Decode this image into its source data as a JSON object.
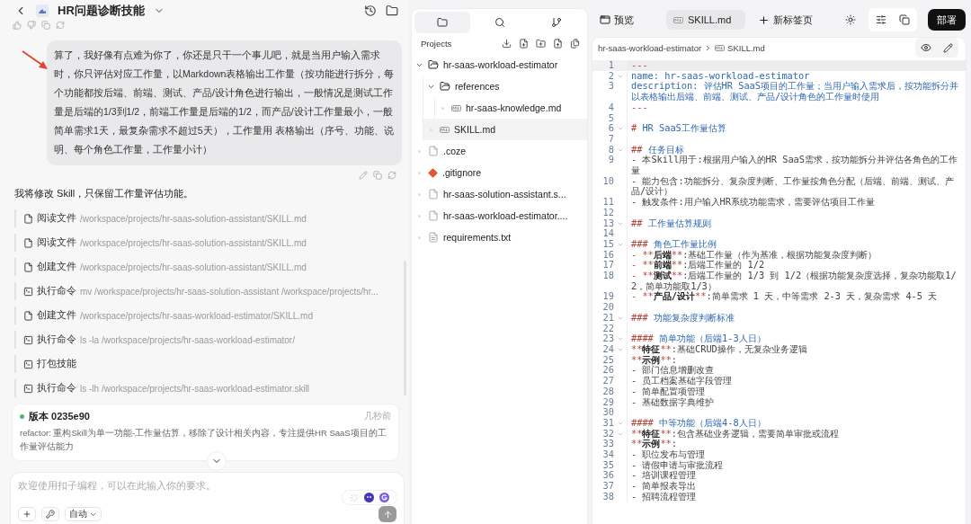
{
  "chat": {
    "title": "HR问题诊断技能",
    "user_message": "算了，我好像有点难为你了，你还是只干一个事儿吧，就是当用户输入需求时，你只评估对应工作量，以Markdown表格输出工作量（按功能进行拆分，每个功能都按后端、前端、测试、产品/设计角色进行输出，一般情况是测试工作量是后端的1/3到1/2，前端工作量是后端的1/2，而产品/设计工作量最小，一般简单需求1天，最复杂需求不超过5天），工作量用 表格输出（序号、功能、说明、每个角色工作量，工作量小计）",
    "assistant_message": "我将修改 Skill，只保留工作量评估功能。",
    "steps": [
      {
        "kind": "file",
        "action": "阅读文件",
        "detail": "/workspace/projects/hr-saas-solution-assistant/SKILL.md"
      },
      {
        "kind": "file",
        "action": "阅读文件",
        "detail": "/workspace/projects/hr-saas-solution-assistant/SKILL.md"
      },
      {
        "kind": "file",
        "action": "创建文件",
        "detail": "/workspace/projects/hr-saas-solution-assistant/SKILL.md"
      },
      {
        "kind": "command",
        "action": "执行命令",
        "detail": "mv /workspace/projects/hr-saas-solution-assistant /workspace/projects/hr..."
      },
      {
        "kind": "file",
        "action": "创建文件",
        "detail": "/workspace/projects/hr-saas-workload-estimator/SKILL.md"
      },
      {
        "kind": "command",
        "action": "执行命令",
        "detail": "ls -la /workspace/projects/hr-saas-workload-estimator/"
      },
      {
        "kind": "command",
        "action": "打包技能"
      },
      {
        "kind": "command",
        "action": "执行命令",
        "detail": "ls -lh /workspace/projects/hr-saas-workload-estimator.skill"
      }
    ],
    "version": {
      "title": "版本 0235e90",
      "time": "几秒前",
      "description": "refactor: 重构Skill为单一功能-工作量估算，移除了设计相关内容，专注提供HR SaaS项目的工作量评估能力"
    },
    "composer": {
      "placeholder": "欢迎使用扣子编程，可以在此输入你的要求。",
      "mode": "自动"
    }
  },
  "explorer": {
    "tabs": [
      {
        "kind": "files",
        "selected": true
      },
      {
        "kind": "search",
        "selected": false
      },
      {
        "kind": "git",
        "selected": false
      }
    ],
    "title": "Projects",
    "tree": [
      {
        "name": "hr-saas-workload-estimator",
        "kind": "folder",
        "expanded": true,
        "selected": false,
        "children": [
          {
            "name": "references",
            "kind": "folder",
            "expanded": true,
            "selected": false,
            "children": [
              {
                "name": "hr-saas-knowledge.md",
                "kind": "markdown",
                "selected": false
              }
            ]
          },
          {
            "name": "SKILL.md",
            "kind": "markdown",
            "selected": true
          }
        ]
      },
      {
        "name": ".coze",
        "kind": "file",
        "selected": false
      },
      {
        "name": ".gitignore",
        "kind": "git",
        "selected": false
      },
      {
        "name": "hr-saas-solution-assistant.s...",
        "kind": "file",
        "selected": false
      },
      {
        "name": "hr-saas-workload-estimator....",
        "kind": "file",
        "selected": false
      },
      {
        "name": "requirements.txt",
        "kind": "text",
        "selected": false
      }
    ]
  },
  "top_bar": {
    "preview": "预览",
    "tabs": [
      {
        "label": "SKILL.md",
        "selected": true
      }
    ],
    "new_tab": "新标签页",
    "deploy": "部署"
  },
  "editor": {
    "breadcrumb": {
      "folder": "hr-saas-workload-estimator",
      "file": "SKILL.md"
    },
    "lines": [
      {
        "n": "1",
        "fold": false,
        "active": true,
        "segs": [
          {
            "kind": "mark",
            "text": "---"
          }
        ]
      },
      {
        "n": "2",
        "fold": true,
        "active": false,
        "segs": [
          {
            "kind": "key",
            "text": "name: hr-saas-workload-estimator"
          }
        ]
      },
      {
        "n": "3",
        "fold": false,
        "active": false,
        "segs": [
          {
            "kind": "key",
            "text": "description: 评估HR SaaS项目的工作量；当用户输入需求后，按功能拆分并以表格输出后端、前端、测试、产品/设计角色的工作量时使用"
          }
        ]
      },
      {
        "n": "4",
        "fold": false,
        "active": false,
        "segs": [
          {
            "kind": "mark",
            "text": "---"
          }
        ]
      },
      {
        "n": "5",
        "fold": false,
        "active": false
      },
      {
        "n": "6",
        "fold": true,
        "active": false,
        "segs": [
          {
            "kind": "mark",
            "text": "# "
          },
          {
            "kind": "heading",
            "text": "HR SaaS工作量估算"
          }
        ]
      },
      {
        "n": "7",
        "fold": false,
        "active": false
      },
      {
        "n": "8",
        "fold": true,
        "active": false,
        "segs": [
          {
            "kind": "mark",
            "text": "## "
          },
          {
            "kind": "heading",
            "text": "任务目标"
          }
        ]
      },
      {
        "n": "9",
        "fold": false,
        "active": false,
        "segs": [
          {
            "kind": "text",
            "text": "- 本Skill用于:根据用户输入的HR SaaS需求，按功能拆分并评估各角色的工作量"
          }
        ]
      },
      {
        "n": "10",
        "fold": false,
        "active": false,
        "segs": [
          {
            "kind": "text",
            "text": "- 能力包含:功能拆分、复杂度判断、工作量按角色分配（后端、前端、测试、产品/设计）"
          }
        ]
      },
      {
        "n": "11",
        "fold": false,
        "active": false,
        "segs": [
          {
            "kind": "text",
            "text": "- 触发条件:用户输入HR系统功能需求，需要评估项目工作量"
          }
        ]
      },
      {
        "n": "12",
        "fold": false,
        "active": false
      },
      {
        "n": "13",
        "fold": true,
        "active": false,
        "segs": [
          {
            "kind": "mark",
            "text": "## "
          },
          {
            "kind": "heading",
            "text": "工作量估算规则"
          }
        ]
      },
      {
        "n": "14",
        "fold": false,
        "active": false
      },
      {
        "n": "15",
        "fold": true,
        "active": false,
        "segs": [
          {
            "kind": "mark",
            "text": "### "
          },
          {
            "kind": "heading",
            "text": "角色工作量比例"
          }
        ]
      },
      {
        "n": "16",
        "fold": false,
        "active": false,
        "segs": [
          {
            "kind": "mark",
            "text": "- **"
          },
          {
            "kind": "bold",
            "text": "后端"
          },
          {
            "kind": "mark",
            "text": "**"
          },
          {
            "kind": "text",
            "text": ":基础工作量（作为基准，根据功能复杂度判断）"
          }
        ]
      },
      {
        "n": "17",
        "fold": false,
        "active": false,
        "segs": [
          {
            "kind": "mark",
            "text": "- **"
          },
          {
            "kind": "bold",
            "text": "前端"
          },
          {
            "kind": "mark",
            "text": "**"
          },
          {
            "kind": "text",
            "text": ":后端工作量的 1/2"
          }
        ]
      },
      {
        "n": "18",
        "fold": false,
        "active": false,
        "segs": [
          {
            "kind": "mark",
            "text": "- **"
          },
          {
            "kind": "bold",
            "text": "测试"
          },
          {
            "kind": "mark",
            "text": "**"
          },
          {
            "kind": "text",
            "text": ":后端工作量的 1/3 到 1/2（根据功能复杂度选择，复杂功能取1/2，简单功能取1/3）"
          }
        ]
      },
      {
        "n": "19",
        "fold": false,
        "active": false,
        "segs": [
          {
            "kind": "mark",
            "text": "- **"
          },
          {
            "kind": "bold",
            "text": "产品/设计"
          },
          {
            "kind": "mark",
            "text": "**"
          },
          {
            "kind": "text",
            "text": ":简单需求 1 天，中等需求 2-3 天，复杂需求 4-5 天"
          }
        ]
      },
      {
        "n": "20",
        "fold": false,
        "active": false
      },
      {
        "n": "21",
        "fold": true,
        "active": false,
        "segs": [
          {
            "kind": "mark",
            "text": "### "
          },
          {
            "kind": "heading",
            "text": "功能复杂度判断标准"
          }
        ]
      },
      {
        "n": "22",
        "fold": false,
        "active": false
      },
      {
        "n": "23",
        "fold": true,
        "active": false,
        "segs": [
          {
            "kind": "mark",
            "text": "#### "
          },
          {
            "kind": "heading",
            "text": "简单功能（后端1-3人日）"
          }
        ]
      },
      {
        "n": "24",
        "fold": true,
        "active": false,
        "segs": [
          {
            "kind": "mark",
            "text": "**"
          },
          {
            "kind": "bold",
            "text": "特征"
          },
          {
            "kind": "mark",
            "text": "**"
          },
          {
            "kind": "text",
            "text": ":基础CRUD操作，无复杂业务逻辑"
          }
        ]
      },
      {
        "n": "25",
        "fold": false,
        "active": false,
        "segs": [
          {
            "kind": "mark",
            "text": "**"
          },
          {
            "kind": "bold",
            "text": "示例"
          },
          {
            "kind": "mark",
            "text": "**"
          },
          {
            "kind": "text",
            "text": ":"
          }
        ]
      },
      {
        "n": "26",
        "fold": false,
        "active": false,
        "segs": [
          {
            "kind": "text",
            "text": "- 部门信息增删改查"
          }
        ]
      },
      {
        "n": "27",
        "fold": false,
        "active": false,
        "segs": [
          {
            "kind": "text",
            "text": "- 员工档案基础字段管理"
          }
        ]
      },
      {
        "n": "28",
        "fold": false,
        "active": false,
        "segs": [
          {
            "kind": "text",
            "text": "- 简单配置项管理"
          }
        ]
      },
      {
        "n": "29",
        "fold": false,
        "active": false,
        "segs": [
          {
            "kind": "text",
            "text": "- 基础数据字典维护"
          }
        ]
      },
      {
        "n": "30",
        "fold": false,
        "active": false
      },
      {
        "n": "31",
        "fold": true,
        "active": false,
        "segs": [
          {
            "kind": "mark",
            "text": "#### "
          },
          {
            "kind": "heading",
            "text": "中等功能（后端4-8人日）"
          }
        ]
      },
      {
        "n": "32",
        "fold": true,
        "active": false,
        "segs": [
          {
            "kind": "mark",
            "text": "**"
          },
          {
            "kind": "bold",
            "text": "特征"
          },
          {
            "kind": "mark",
            "text": "**"
          },
          {
            "kind": "text",
            "text": ":包含基础业务逻辑，需要简单审批或流程"
          }
        ]
      },
      {
        "n": "33",
        "fold": false,
        "active": false,
        "segs": [
          {
            "kind": "mark",
            "text": "**"
          },
          {
            "kind": "bold",
            "text": "示例"
          },
          {
            "kind": "mark",
            "text": "**"
          },
          {
            "kind": "text",
            "text": ":"
          }
        ]
      },
      {
        "n": "34",
        "fold": false,
        "active": false,
        "segs": [
          {
            "kind": "text",
            "text": "- 职位发布与管理"
          }
        ]
      },
      {
        "n": "35",
        "fold": false,
        "active": false,
        "segs": [
          {
            "kind": "text",
            "text": "- 请假申请与审批流程"
          }
        ]
      },
      {
        "n": "36",
        "fold": false,
        "active": false,
        "segs": [
          {
            "kind": "text",
            "text": "- 培训课程管理"
          }
        ]
      },
      {
        "n": "37",
        "fold": false,
        "active": false,
        "segs": [
          {
            "kind": "text",
            "text": "- 简单报表导出"
          }
        ]
      },
      {
        "n": "38",
        "fold": false,
        "active": false,
        "segs": [
          {
            "kind": "text",
            "text": "- 招聘流程管理"
          }
        ]
      }
    ]
  }
}
